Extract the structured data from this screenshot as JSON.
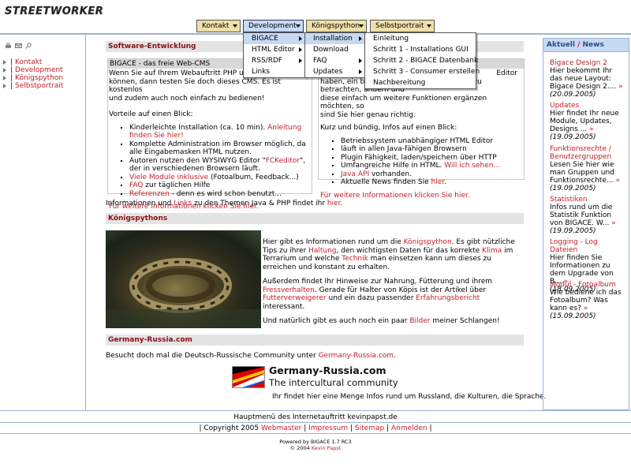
{
  "logo_text": "STREETWORKER",
  "topnav": {
    "items": [
      {
        "label": "Kontakt"
      },
      {
        "label": "Development"
      },
      {
        "label": "Königspython"
      },
      {
        "label": "Selbstportrait"
      }
    ]
  },
  "menu_l1": [
    "BIGACE",
    "HTML Editor",
    "RSS/RDF",
    "Links"
  ],
  "menu_l2": [
    "Installation",
    "Download",
    "FAQ",
    "Updates"
  ],
  "menu_l3": [
    "Einleitung",
    "Schritt 1 - Installations GUI",
    "Schritt 2 - BIGACE Datenbank",
    "Schritt 3 - Consumer erstellen",
    "Nachbereitung"
  ],
  "leftnav": {
    "items": [
      "Kontakt",
      "Development",
      "Königspython",
      "Selbstportrait"
    ]
  },
  "software": {
    "heading": "Software-Entwicklung",
    "bigace_head": "BIGACE - das freie Web-CMS",
    "bigace_intro_1": "Wenn Sie auf Ihrem Webauftritt PHP und",
    "bigace_intro_2": "können, dann testen Sie doch dieses CMS. Es ist kostenlos",
    "bigace_intro_3": "und zudem auch noch einfach zu bedienen!",
    "vorteile": "Vorteile auf einen Blick:",
    "bullets": [
      {
        "pre": "Kinderleichte Installation (ca. 10 min). ",
        "link": "Anleitung finden Sie hier!",
        "post": ""
      },
      {
        "pre": "Komplette Administration im Browser möglich, da alle Eingabemasken HTML nutzen.",
        "link": "",
        "post": ""
      },
      {
        "pre": "Autoren nutzen den WYSIWYG Editor \"",
        "link": "FCKeditor",
        "post": "\", der in verschiedenen Browsern läuft."
      },
      {
        "pre": "",
        "link": "Viele Module inklusive",
        "post": " (Fotoalbum, Feedback...)"
      },
      {
        "pre": "",
        "link": "FAQ",
        "post": " zur täglichen Hilfe"
      },
      {
        "pre": "",
        "link": "Referenzen",
        "post": " - denn es wird schon benutzt..."
      }
    ],
    "more": "Für weitere Informationen klicken Sie hier.",
    "editor_intro_1": "Editor",
    "editor_intro_2": "haben, ein bestehendes HTML-Dokumente zu betrachten, ändern und",
    "editor_intro_3": "diese einfach um weitere Funktionen ergänzen möchten, so",
    "editor_intro_4": "sind Sie hier genau richtig.",
    "editor_kurz": "Kurz und bündig, Infos auf einen Blick:",
    "editor_bullets": [
      {
        "pre": "Betriebssystem unabhängiger HTML Editor",
        "link": "",
        "post": ""
      },
      {
        "pre": "läuft in allen Java-fähigen Browsern",
        "link": "",
        "post": ""
      },
      {
        "pre": "Plugin Fähigkeit, laden/speichern über HTTP",
        "link": "",
        "post": ""
      },
      {
        "pre": "Umfangreiche Hilfe in HTML. ",
        "link": "Will ich sehen...",
        "post": ""
      },
      {
        "pre": "",
        "link": "Java API",
        "post": " vorhanden."
      },
      {
        "pre": "Aktuelle News finden Sie ",
        "link": "hier",
        "post": "."
      }
    ],
    "editor_more": "Für weitere Informationen klicken Sie hier.",
    "java_pre": "Informationen und ",
    "java_link1": "Links",
    "java_mid": " zu den Themen Java & PHP findet ihr ",
    "java_link2": "hier",
    "java_post": "."
  },
  "python": {
    "heading": "Königspythons",
    "p1_pre": "Hier gibt es Informationen rund um die ",
    "p1_link": "Königspython",
    "p1_post": ". Es gibt nützliche Tips zu ihrer ",
    "p1_link2": "Haltung",
    "p1_post2": ", den wichtigsten Daten für das korrekte ",
    "p1_link3": "Klima",
    "p1_post3": " im Terrarium und welche ",
    "p1_link4": "Technik",
    "p1_post4": " man einsetzen kann um dieses zu erreichen und konstant zu erhalten.",
    "p2_pre": "Außerdem findet Ihr Hinweise zur Nahrung, Fütterung und ihrem ",
    "p2_link": "Fressverhalten",
    "p2_post": ". Gerade für Halter von Köpis ist der Artikel über ",
    "p2_link2": "Futterverweigerer",
    "p2_post2": " und ein dazu passender ",
    "p2_link3": "Erfahrungsbericht",
    "p2_post3": " interessant.",
    "p3_pre": "Und natürlich gibt es auch noch ein paar ",
    "p3_link": "Bilder",
    "p3_post": " meiner Schlangen!"
  },
  "germany": {
    "heading": "Germany-Russia.com",
    "text_pre": "Besucht doch mal die Deutsch-Russische Community unter ",
    "text_link": "Germany-Russia.com",
    "text_post": ".",
    "banner_title": "Germany-Russia.com",
    "banner_sub": "The intercultural community",
    "banner_text": "Ihr findet hier eine Menge Infos rund um Russland, die Kulturen, die Sprache."
  },
  "news": {
    "heading_a": "Aktuell",
    "heading_sep": " / ",
    "heading_b": "News",
    "items": [
      {
        "title": "Bigace Design 2",
        "text": "Hier bekommt Ihr das neue Layout: Bigace Design 2....",
        "date": "(20.09.2005)"
      },
      {
        "title": "Updates",
        "text": "Hier findet Ihr neue Module, Updates, Designs ...",
        "date": "(19.09.2005)"
      },
      {
        "title": "Funktionsrechte / Benutzergruppen",
        "text": "Lesen Sie hier wie man Gruppen und Funktionsrechte...",
        "date": "(19.09.2005)"
      },
      {
        "title": "Statistiken",
        "text": "Infos rund um die Statistik Funktion von BIGACE. W...",
        "date": "(19.09.2005)"
      },
      {
        "title": "Logging - Log Dateien",
        "text": "Hier finden Sie Informationen zu dem Upgrade von B...",
        "date": "(18.09.2005)"
      },
      {
        "title": "Modul - Fotoalbum",
        "text": "Wie bediene ich das Fotoalbum? Was kann es?",
        "date": "(15.09.2005)"
      }
    ]
  },
  "footer": {
    "title": "Hauptmenü des Internetauftritt kevinpapst.de",
    "copyright": "| Copyright 2005 ",
    "links": [
      "Webmaster",
      "Impressum",
      "Sitemap",
      "Anmelden"
    ],
    "sep": " | ",
    "end": " |",
    "powered": "Powered by BIGACE 1.7 RC3",
    "year": "© 2004 ",
    "author": "Kevin Papst"
  }
}
